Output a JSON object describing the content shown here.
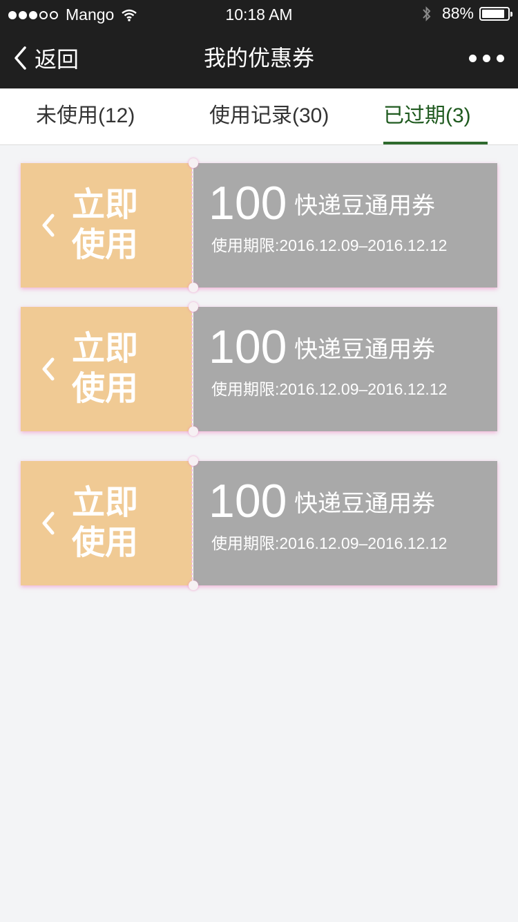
{
  "status_bar": {
    "carrier": "Mango",
    "time": "10:18 AM",
    "battery_percent_text": "88%",
    "battery_level": 0.88,
    "signal_bars_filled": 3,
    "signal_bars_total": 5
  },
  "nav": {
    "back_label": "返回",
    "title": "我的优惠券"
  },
  "tabs": [
    {
      "label": "未使用(12)",
      "active": false
    },
    {
      "label": "使用记录(30)",
      "active": false
    },
    {
      "label": "已过期(3)",
      "active": true
    }
  ],
  "coupons": [
    {
      "use_line1": "立即",
      "use_line2": "使用",
      "amount": "100",
      "title": "快递豆通用券",
      "validity": "使用期限:2016.12.09–2016.12.12"
    },
    {
      "use_line1": "立即",
      "use_line2": "使用",
      "amount": "100",
      "title": "快递豆通用券",
      "validity": "使用期限:2016.12.09–2016.12.12"
    },
    {
      "use_line1": "立即",
      "use_line2": "使用",
      "amount": "100",
      "title": "快递豆通用券",
      "validity": "使用期限:2016.12.09–2016.12.12"
    }
  ],
  "colors": {
    "bar_bg": "#1f1f1f",
    "active_tab": "#1f5a1f",
    "stub": "#f0ca94",
    "coupon_body": "#a9a9a9",
    "page_bg": "#f3f4f6"
  }
}
